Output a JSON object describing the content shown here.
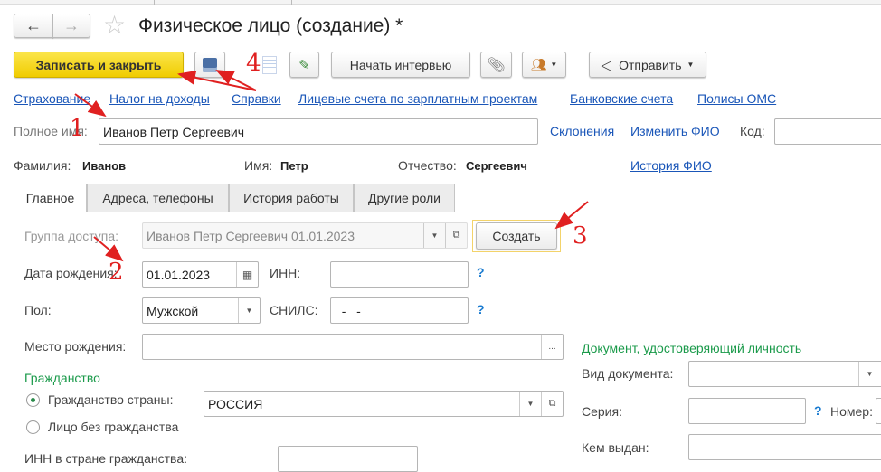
{
  "window": {
    "title": "Физическое лицо (создание) *"
  },
  "toolbar": {
    "save_close": "Записать и закрыть",
    "interview": "Начать интервью",
    "send": "Отправить"
  },
  "links": [
    "Страхование",
    "Налог на доходы",
    "Справки",
    "Лицевые счета по зарплатным проектам",
    "Банковские счета",
    "Полисы ОМС"
  ],
  "header": {
    "full_name_label": "Полное имя:",
    "full_name": "Иванов Петр Сергеевич",
    "declensions": "Склонения",
    "change_fio": "Изменить ФИО",
    "code_label": "Код:",
    "code": "",
    "surname_label": "Фамилия:",
    "surname": "Иванов",
    "name_label": "Имя:",
    "name": "Петр",
    "patronymic_label": "Отчество:",
    "patronymic": "Сергеевич",
    "fio_history": "История ФИО"
  },
  "tabs": [
    "Главное",
    "Адреса, телефоны",
    "История работы",
    "Другие роли"
  ],
  "main": {
    "access_group_label": "Группа доступа:",
    "access_group": "Иванов Петр Сергеевич 01.01.2023",
    "create": "Создать",
    "birth_date_label": "Дата рождения:",
    "birth_date": "01.01.2023",
    "inn_label": "ИНН:",
    "inn": "",
    "help": "?",
    "gender_label": "Пол:",
    "gender": "Мужской",
    "snils_label": "СНИЛС:",
    "snils": "  -   -",
    "birthplace_label": "Место рождения:",
    "birthplace": "",
    "ellipsis": "...",
    "citizenship_title": "Гражданство",
    "citizen_country_label": "Гражданство страны:",
    "country": "РОССИЯ",
    "stateless_label": "Лицо без гражданства",
    "foreign_inn_label": "ИНН в стране гражданства:"
  },
  "document": {
    "title": "Документ, удостоверяющий личность",
    "type_label": "Вид документа:",
    "series_label": "Серия:",
    "number_label": "Номер:",
    "issued_by_label": "Кем выдан:"
  },
  "annotations": [
    "1",
    "2",
    "3",
    "4"
  ]
}
